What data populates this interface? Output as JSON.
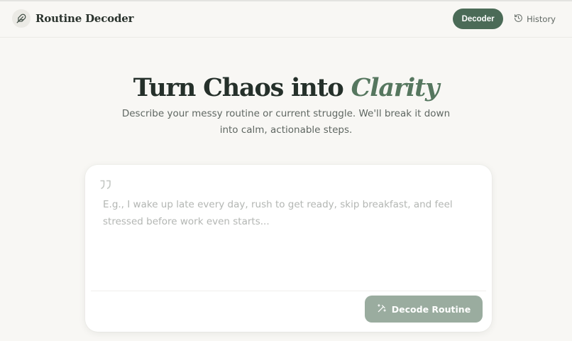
{
  "app": {
    "brand_name": "Routine Decoder",
    "logo_icon": "feather-icon"
  },
  "nav": {
    "items": [
      {
        "label": "Decoder",
        "active": true
      },
      {
        "label": "History",
        "active": false,
        "icon": "history-clock-icon"
      }
    ]
  },
  "hero": {
    "title_prefix": "Turn Chaos into ",
    "title_accent": "Clarity",
    "subtitle": "Describe your messy routine or current struggle. We'll break it down into calm, actionable steps."
  },
  "input": {
    "value": "",
    "placeholder": "E.g., I wake up late every day, rush to get ready, skip breakfast, and feel stressed before work even starts...",
    "icon": "quote-icon"
  },
  "actions": {
    "decode_label": "Decode Routine",
    "decode_icon": "magic-wand-icon",
    "decode_enabled": false
  },
  "colors": {
    "background": "#f8f7f4",
    "accent": "#4b6b57",
    "accent_text": "#56775f",
    "button_disabled": "#9aac9f"
  }
}
